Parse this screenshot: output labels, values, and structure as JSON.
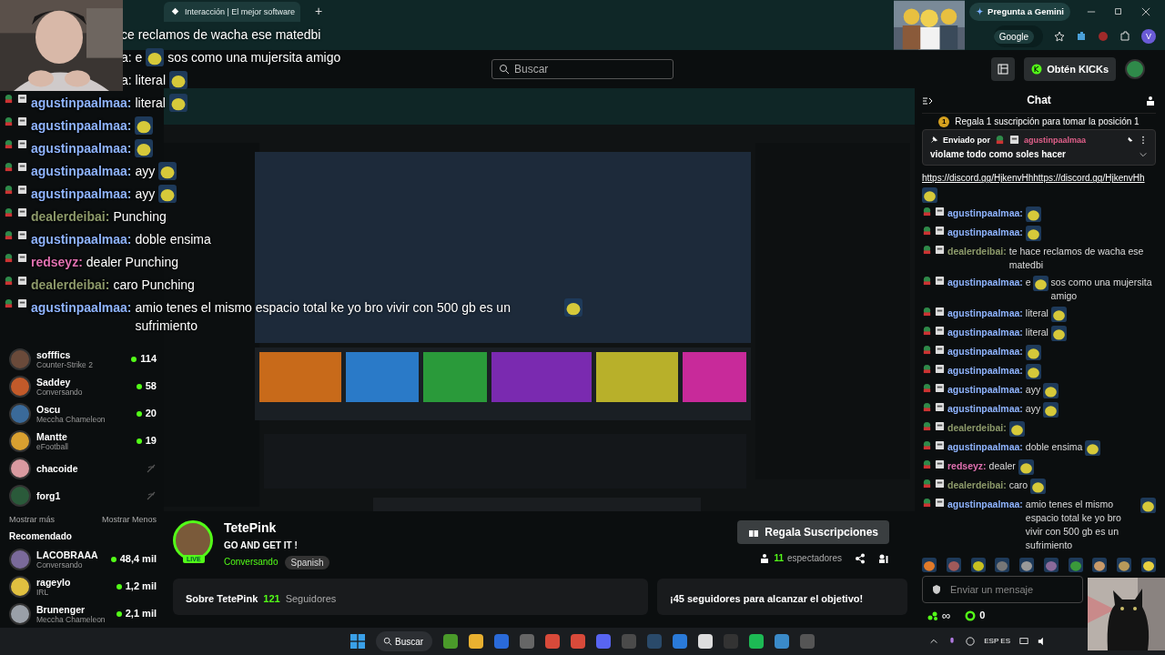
{
  "browser": {
    "tab_title": "Interacción | El mejor software",
    "new_tab": "+",
    "gemini": "Pregunta a Gemini",
    "search_engine": "Google",
    "profile": "V"
  },
  "header": {
    "search": {
      "placeholder": "Buscar"
    },
    "kicks_button": "Obtén KICKs"
  },
  "overlay_chat": [
    {
      "kind": "partial",
      "text": "ce reclamos de wacha ese matedbi"
    },
    {
      "kind": "partial",
      "text": "a: e",
      "emote": true,
      "after": "sos como una mujersita amigo"
    },
    {
      "kind": "partial",
      "text": "a: literal",
      "emote": true
    },
    {
      "kind": "full",
      "user": "agustinpaalmaa:",
      "color": "#8fb4ff",
      "text": "literal",
      "emote": true
    },
    {
      "kind": "full",
      "user": "agustinpaalmaa:",
      "color": "#8fb4ff",
      "emote": true
    },
    {
      "kind": "full",
      "user": "agustinpaalmaa:",
      "color": "#8fb4ff",
      "emote": true
    },
    {
      "kind": "full",
      "user": "agustinpaalmaa:",
      "color": "#8fb4ff",
      "text": "ayy",
      "emote": true
    },
    {
      "kind": "full",
      "user": "agustinpaalmaa:",
      "color": "#8fb4ff",
      "text": "ayy",
      "emote": true
    },
    {
      "kind": "full",
      "user": "dealerdeibai:",
      "color": "#8d9a6a",
      "text": "Punching"
    },
    {
      "kind": "full",
      "user": "agustinpaalmaa:",
      "color": "#8fb4ff",
      "text": "doble ensima"
    },
    {
      "kind": "full",
      "user": "redseyz:",
      "color": "#e070b0",
      "text": "dealer Punching"
    },
    {
      "kind": "full",
      "user": "dealerdeibai:",
      "color": "#8d9a6a",
      "text": "caro Punching"
    },
    {
      "kind": "full",
      "user": "agustinpaalmaa:",
      "color": "#8fb4ff",
      "text": "amio tenes el mismo espacio total ke yo bro vivir con 500 gb es un sufrimiento",
      "emote": true
    }
  ],
  "following": [
    {
      "name": "sofffics",
      "category": "Counter-Strike 2",
      "kind": "live",
      "viewers": "114"
    },
    {
      "name": "Saddey",
      "category": "Conversando",
      "kind": "live",
      "viewers": "58"
    },
    {
      "name": "Oscu",
      "category": "Meccha Chameleon",
      "kind": "live",
      "viewers": "20"
    },
    {
      "name": "Mantte",
      "category": "eFootball",
      "kind": "live",
      "viewers": "19"
    },
    {
      "name": "chacoide",
      "kind": "offline"
    },
    {
      "name": "forg1",
      "kind": "offline"
    }
  ],
  "show_more": "Mostrar más",
  "show_less": "Mostrar Menos",
  "recommended_title": "Recomendado",
  "recommended": [
    {
      "name": "LACOBRAAA",
      "category": "Conversando",
      "kind": "live",
      "viewers": "48,4 mil"
    },
    {
      "name": "rageylo",
      "category": "IRL",
      "kind": "live",
      "viewers": "1,2 mil"
    },
    {
      "name": "Brunenger",
      "category": "Meccha Chameleon",
      "kind": "live",
      "viewers": "2,1 mil"
    }
  ],
  "stream": {
    "name": "TetePink",
    "title": "GO AND GET IT !",
    "live_badge": "LIVE",
    "category": "Conversando",
    "tag": "Spanish",
    "gift_button": "Regala Suscripciones",
    "viewers_count": "11",
    "viewers_label": "espectadores",
    "about": "Sobre TetePink",
    "followers_count": "121",
    "followers_label": "Seguidores",
    "goal": "¡45 seguidores para alcanzar el objetivo!"
  },
  "chat": {
    "title": "Chat",
    "gift_rank": "1",
    "gift_prompt": "Regala 1 suscripción para tomar la posición 1",
    "pinned": {
      "label": "Enviado por",
      "user": "agustinpaalmaa",
      "text": "violame todo como soles hacer"
    },
    "messages": [
      {
        "kind": "link",
        "text": "https://discord.gg/HjkenvHhhttps://discord.gg/HjkenvHh",
        "emote": true
      },
      {
        "kind": "message",
        "user": "agustinpaalmaa:",
        "color": "#8fb4ff",
        "emote": true
      },
      {
        "kind": "message",
        "user": "agustinpaalmaa:",
        "color": "#8fb4ff",
        "emote": true
      },
      {
        "kind": "message",
        "user": "dealerdeibai:",
        "color": "#8d9a6a",
        "text": "te hace reclamos de wacha ese matedbi"
      },
      {
        "kind": "message",
        "user": "agustinpaalmaa:",
        "color": "#8fb4ff",
        "text": "e",
        "emote": true,
        "after": "sos como una mujersita amigo"
      },
      {
        "kind": "message",
        "user": "agustinpaalmaa:",
        "color": "#8fb4ff",
        "text": "literal",
        "emote": true
      },
      {
        "kind": "message",
        "user": "agustinpaalmaa:",
        "color": "#8fb4ff",
        "text": "literal",
        "emote": true
      },
      {
        "kind": "message",
        "user": "agustinpaalmaa:",
        "color": "#8fb4ff",
        "emote": true
      },
      {
        "kind": "message",
        "user": "agustinpaalmaa:",
        "color": "#8fb4ff",
        "emote": true
      },
      {
        "kind": "message",
        "user": "agustinpaalmaa:",
        "color": "#8fb4ff",
        "text": "ayy",
        "emote": true
      },
      {
        "kind": "message",
        "user": "agustinpaalmaa:",
        "color": "#8fb4ff",
        "text": "ayy",
        "emote": true
      },
      {
        "kind": "message",
        "user": "dealerdeibai:",
        "color": "#8d9a6a",
        "emote": true
      },
      {
        "kind": "message",
        "user": "agustinpaalmaa:",
        "color": "#8fb4ff",
        "text": "doble ensima",
        "emote": true
      },
      {
        "kind": "message",
        "user": "redseyz:",
        "color": "#e070b0",
        "text": "dealer",
        "emote": true
      },
      {
        "kind": "message",
        "user": "dealerdeibai:",
        "color": "#8d9a6a",
        "text": "caro",
        "emote": true
      },
      {
        "kind": "message",
        "user": "agustinpaalmaa:",
        "color": "#8fb4ff",
        "text": "amio tenes el mismo espacio total ke yo bro vivir con 500 gb es un sufrimiento",
        "emote": true
      }
    ],
    "input": {
      "placeholder": "Enviar un mensaje"
    },
    "points": "∞",
    "kicks": "0"
  },
  "taskbar": {
    "search": "Buscar",
    "tray_lang": "ESP ES"
  }
}
